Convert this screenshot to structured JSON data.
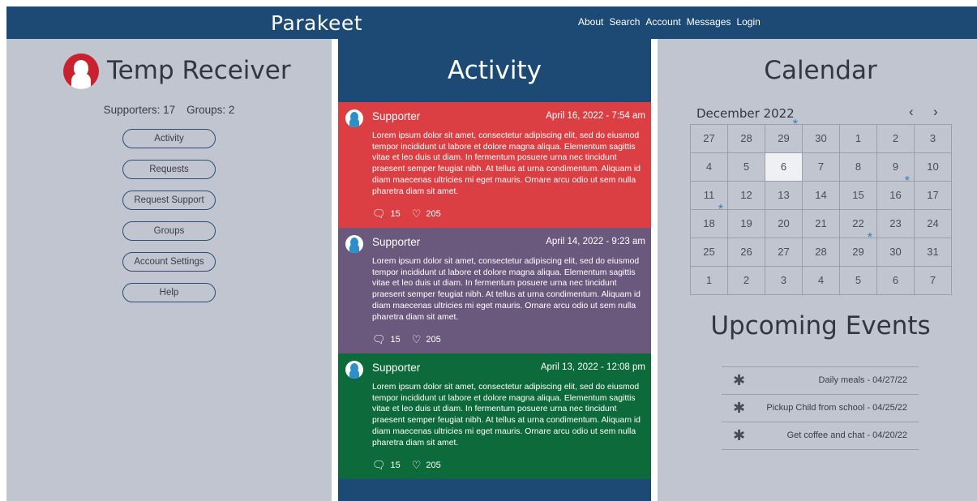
{
  "header": {
    "logo": "Parakeet",
    "nav": [
      "About",
      "Search",
      "Account",
      "Messages",
      "Login"
    ]
  },
  "profile": {
    "name": "Temp Receiver",
    "supporters_label": "Supporters: 17",
    "groups_label": "Groups: 2",
    "menu": [
      "Activity",
      "Requests",
      "Request Support",
      "Groups",
      "Account Settings",
      "Help"
    ]
  },
  "activity": {
    "title": "Activity",
    "posts": [
      {
        "author": "Supporter",
        "date": "April 16, 2022 - 7:54 am",
        "body": "Lorem ipsum dolor sit amet, consectetur adipiscing elit, sed do eiusmod tempor incididunt ut labore et dolore magna aliqua. Elementum sagittis vitae et leo duis ut diam. In fermentum posuere urna nec tincidunt praesent semper feugiat nibh. At tellus at urna condimentum. Aliquam id diam maecenas ultricies mi eget mauris. Ornare arcu odio ut sem nulla pharetra diam sit amet.",
        "comments": "15",
        "likes": "205",
        "color": "#db3f44"
      },
      {
        "author": "Supporter",
        "date": "April 14, 2022 - 9:23 am",
        "body": "Lorem ipsum dolor sit amet, consectetur adipiscing elit, sed do eiusmod tempor incididunt ut labore et dolore magna aliqua. Elementum sagittis vitae et leo duis ut diam. In fermentum posuere urna nec tincidunt praesent semper feugiat nibh. At tellus at urna condimentum. Aliquam id diam maecenas ultricies mi eget mauris. Ornare arcu odio ut sem nulla pharetra diam sit amet.",
        "comments": "15",
        "likes": "205",
        "color": "#6a587d"
      },
      {
        "author": "Supporter",
        "date": "April 13, 2022 - 12:08 pm",
        "body": "Lorem ipsum dolor sit amet, consectetur adipiscing elit, sed do eiusmod tempor incididunt ut labore et dolore magna aliqua. Elementum sagittis vitae et leo duis ut diam. In fermentum posuere urna nec tincidunt praesent semper feugiat nibh. At tellus at urna condimentum. Aliquam id diam maecenas ultricies mi eget mauris. Ornare arcu odio ut sem nulla pharetra diam sit amet.",
        "comments": "15",
        "likes": "205",
        "color": "#0d6a3a"
      }
    ]
  },
  "calendar": {
    "title": "Calendar",
    "month": "December 2022",
    "prev_icon": "chevron-left-icon",
    "next_icon": "chevron-right-icon",
    "days": [
      [
        "27",
        "28",
        "29",
        "30",
        "1",
        "2",
        "3"
      ],
      [
        "4",
        "5",
        "6",
        "7",
        "8",
        "9",
        "10"
      ],
      [
        "11",
        "12",
        "13",
        "14",
        "15",
        "16",
        "17"
      ],
      [
        "18",
        "19",
        "20",
        "21",
        "22",
        "23",
        "24"
      ],
      [
        "25",
        "26",
        "27",
        "28",
        "29",
        "30",
        "31"
      ],
      [
        "1",
        "2",
        "3",
        "4",
        "5",
        "6",
        "7"
      ]
    ],
    "today": [
      1,
      2
    ],
    "event_marks": [
      [
        0,
        2
      ],
      [
        2,
        5
      ],
      [
        3,
        0
      ],
      [
        4,
        4
      ]
    ],
    "mark_color": "#2e7fbf"
  },
  "events": {
    "title": "Upcoming Events",
    "icon": "asterisk-icon",
    "items": [
      "Daily meals - 04/27/22",
      "Pickup Child from school - 04/25/22",
      "Get coffee and chat - 04/20/22"
    ]
  }
}
